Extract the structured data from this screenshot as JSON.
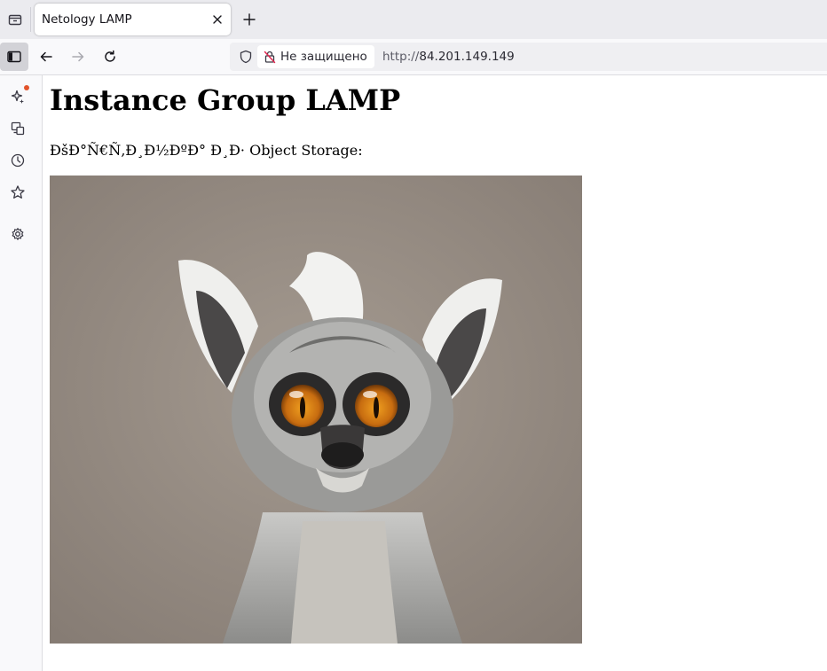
{
  "browser": {
    "tab": {
      "title": "Netology LAMP"
    },
    "address": {
      "security_label": "Не защищено",
      "scheme": "http://",
      "host": "84.201.149.149"
    }
  },
  "sidebar": {
    "items": [
      {
        "icon": "ai-sparkle-icon",
        "has_notification": true
      },
      {
        "icon": "synced-tabs-icon"
      },
      {
        "icon": "history-icon"
      },
      {
        "icon": "bookmarks-star-icon"
      },
      {
        "icon": "settings-gear-icon"
      }
    ]
  },
  "page": {
    "heading": "Instance Group LAMP",
    "paragraph": "ÐšÐ°Ñ€Ñ‚Ð¸Ð½ÐºÐ° Ð¸Ð· Object Storage:",
    "image_subject": "ring-tailed lemur photo"
  },
  "colors": {
    "tab_strip": "#ebebef",
    "toolbar": "#f9f9fb",
    "notification_dot": "#e2542c",
    "image_background": "#8f867e"
  }
}
